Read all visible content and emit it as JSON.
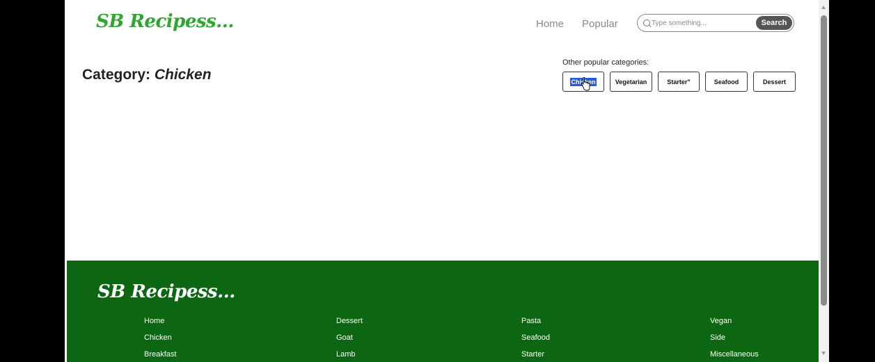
{
  "header": {
    "brand": "SB Recipess...",
    "nav": {
      "home": "Home",
      "popular": "Popular"
    },
    "search": {
      "placeholder": "Type something...",
      "button": "Search"
    }
  },
  "main": {
    "title_prefix": "Category: ",
    "category": "Chicken",
    "other_label": "Other popular categories:",
    "chips": [
      "Chicken",
      "Vegetarian",
      "Starter\"",
      "Seafood",
      "Dessert"
    ]
  },
  "footer": {
    "brand": "SB Recipess...",
    "columns": [
      [
        "Home",
        "Chicken",
        "Breakfast"
      ],
      [
        "Dessert",
        "Goat",
        "Lamb"
      ],
      [
        "Pasta",
        "Seafood",
        "Starter"
      ],
      [
        "Vegan",
        "Side",
        "Miscellaneous"
      ]
    ]
  },
  "colors": {
    "brand_green": "#2fa62f",
    "footer_green": "#0c6612",
    "selection": "#2b5bd7"
  }
}
